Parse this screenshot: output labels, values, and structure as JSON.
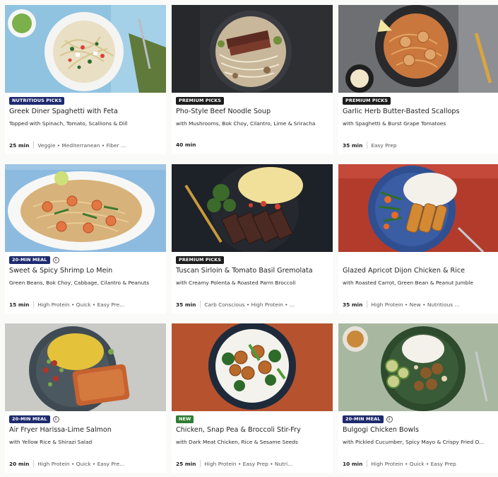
{
  "recipes": [
    {
      "badge": "NUTRITIOUS PICKS",
      "badge_style": "navy",
      "info": false,
      "title": "Greek Diner Spaghetti with Feta",
      "subtitle": "Topped with Spinach, Tomato, Scallions & Dill",
      "time": "25 min",
      "tags": "Veggie • Mediterranean • Fiber ...",
      "image": "pasta-plate"
    },
    {
      "badge": "PREMIUM PICKS",
      "badge_style": "dark",
      "info": false,
      "title": "Pho-Style Beef Noodle Soup",
      "subtitle": "with Mushrooms, Bok Choy, Cilantro, Lime & Sriracha",
      "time": "40 min",
      "tags": "",
      "image": "noodle-soup"
    },
    {
      "badge": "PREMIUM PICKS",
      "badge_style": "dark",
      "info": false,
      "title": "Garlic Herb Butter-Basted Scallops",
      "subtitle": "with Spaghetti & Burst Grape Tomatoes",
      "time": "35 min",
      "tags": "Easy Prep",
      "image": "scallop-pasta"
    },
    {
      "badge": "20-MIN MEAL",
      "badge_style": "navy",
      "info": true,
      "title": "Sweet & Spicy Shrimp Lo Mein",
      "subtitle": "Green Beans, Bok Choy, Cabbage, Cilantro & Peanuts",
      "time": "15 min",
      "tags": "High Protein • Quick • Easy Pre...",
      "image": "shrimp-noodles"
    },
    {
      "badge": "PREMIUM PICKS",
      "badge_style": "dark",
      "info": false,
      "title": "Tuscan Sirloin & Tomato Basil Gremolata",
      "subtitle": "with Creamy Polenta & Roasted Parm Broccoli",
      "time": "35 min",
      "tags": "Carb Conscious • High Protein • ...",
      "image": "steak-polenta"
    },
    {
      "badge": "",
      "badge_style": "",
      "info": false,
      "title": "Glazed Apricot Dijon Chicken & Rice",
      "subtitle": "with Roasted Carrot, Green Bean & Peanut Jumble",
      "time": "35 min",
      "tags": "High Protein • New • Nutritious ...",
      "image": "chicken-rice"
    },
    {
      "badge": "20-MIN MEAL",
      "badge_style": "navy",
      "info": true,
      "title": "Air Fryer Harissa-Lime Salmon",
      "subtitle": "with Yellow Rice & Shirazi Salad",
      "time": "20 min",
      "tags": "High Protein • Quick • Easy Pre...",
      "image": "salmon-rice"
    },
    {
      "badge": "NEW",
      "badge_style": "green",
      "info": false,
      "title": "Chicken, Snap Pea & Broccoli Stir-Fry",
      "subtitle": "with Dark Meat Chicken, Rice & Sesame Seeds",
      "time": "25 min",
      "tags": "High Protein • Easy Prep • Nutri...",
      "image": "stir-fry"
    },
    {
      "badge": "20-MIN MEAL",
      "badge_style": "navy",
      "info": true,
      "title": "Bulgogi Chicken Bowls",
      "subtitle": "with Pickled Cucumber, Spicy Mayo & Crispy Fried O...",
      "time": "10 min",
      "tags": "High Protein • Quick • Easy Prep",
      "image": "bulgogi-bowl"
    }
  ],
  "colors": {
    "nutritious_badge": "#1e2a6e",
    "premium_badge": "#1c1c1c",
    "new_badge": "#2f7d32"
  }
}
